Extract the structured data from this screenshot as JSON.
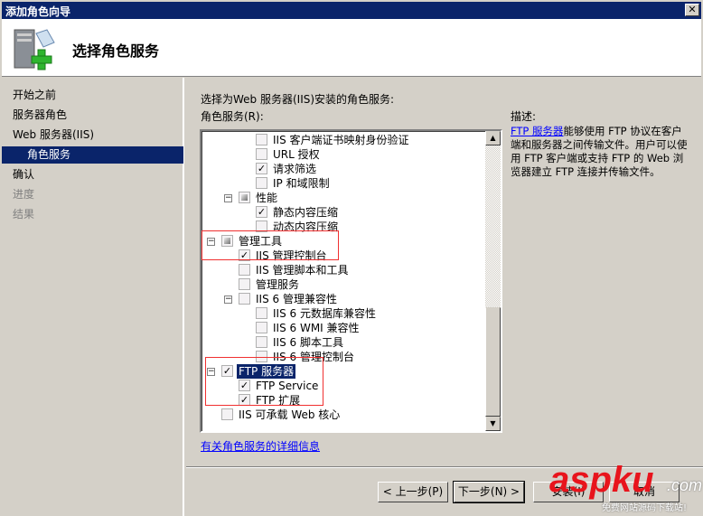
{
  "window": {
    "title": "添加角色向导",
    "close": "✕"
  },
  "header": {
    "title": "选择角色服务",
    "icon": "server-add-icon"
  },
  "sidebar": {
    "items": [
      {
        "label": "开始之前",
        "state": "normal"
      },
      {
        "label": "服务器角色",
        "state": "normal"
      },
      {
        "label": "Web 服务器(IIS)",
        "state": "normal"
      },
      {
        "label": "角色服务",
        "state": "selected"
      },
      {
        "label": "确认",
        "state": "normal"
      },
      {
        "label": "进度",
        "state": "disabled"
      },
      {
        "label": "结果",
        "state": "disabled"
      }
    ]
  },
  "main": {
    "intro": "选择为Web 服务器(IIS)安装的角色服务:",
    "list_label": "角色服务(R):",
    "tree": [
      {
        "label": "IIS 客户端证书映射身份验证",
        "level": 3,
        "state": "unchecked"
      },
      {
        "label": "URL 授权",
        "level": 3,
        "state": "unchecked"
      },
      {
        "label": "请求筛选",
        "level": 3,
        "state": "checked"
      },
      {
        "label": "IP 和域限制",
        "level": 3,
        "state": "unchecked"
      },
      {
        "label": "性能",
        "level": 2,
        "state": "partial",
        "expander": "⊟"
      },
      {
        "label": "静态内容压缩",
        "level": 3,
        "state": "checked"
      },
      {
        "label": "动态内容压缩",
        "level": 3,
        "state": "unchecked"
      },
      {
        "label": "管理工具",
        "level": 1,
        "state": "partial",
        "expander": "⊟"
      },
      {
        "label": "IIS 管理控制台",
        "level": 2,
        "state": "checked"
      },
      {
        "label": "IIS 管理脚本和工具",
        "level": 2,
        "state": "unchecked"
      },
      {
        "label": "管理服务",
        "level": 2,
        "state": "unchecked"
      },
      {
        "label": "IIS 6 管理兼容性",
        "level": 2,
        "state": "unchecked",
        "expander": "⊟"
      },
      {
        "label": "IIS 6 元数据库兼容性",
        "level": 3,
        "state": "unchecked"
      },
      {
        "label": "IIS 6 WMI 兼容性",
        "level": 3,
        "state": "unchecked"
      },
      {
        "label": "IIS 6 脚本工具",
        "level": 3,
        "state": "unchecked"
      },
      {
        "label": "IIS 6 管理控制台",
        "level": 3,
        "state": "unchecked"
      },
      {
        "label": "FTP 服务器",
        "level": 1,
        "state": "checked",
        "expander": "⊟",
        "selected": true
      },
      {
        "label": "FTP Service",
        "level": 2,
        "state": "checked"
      },
      {
        "label": "FTP 扩展",
        "level": 2,
        "state": "checked"
      },
      {
        "label": "IIS 可承载 Web 核心",
        "level": 1,
        "state": "unchecked"
      }
    ],
    "more_link": "有关角色服务的详细信息"
  },
  "description": {
    "label": "描述:",
    "link": "FTP 服务器",
    "text": "能够使用 FTP 协议在客户端和服务器之间传输文件。用户可以使用 FTP 客户端或支持 FTP 的 Web 浏览器建立 FTP 连接并传输文件。"
  },
  "buttons": {
    "prev": "< 上一步(P)",
    "next": "下一步(N) >",
    "install": "安装(I)",
    "cancel": "取消"
  },
  "watermark": {
    "brand": "aspku",
    "suffix": ".com",
    "tagline": "免费网站源码下载站!"
  }
}
